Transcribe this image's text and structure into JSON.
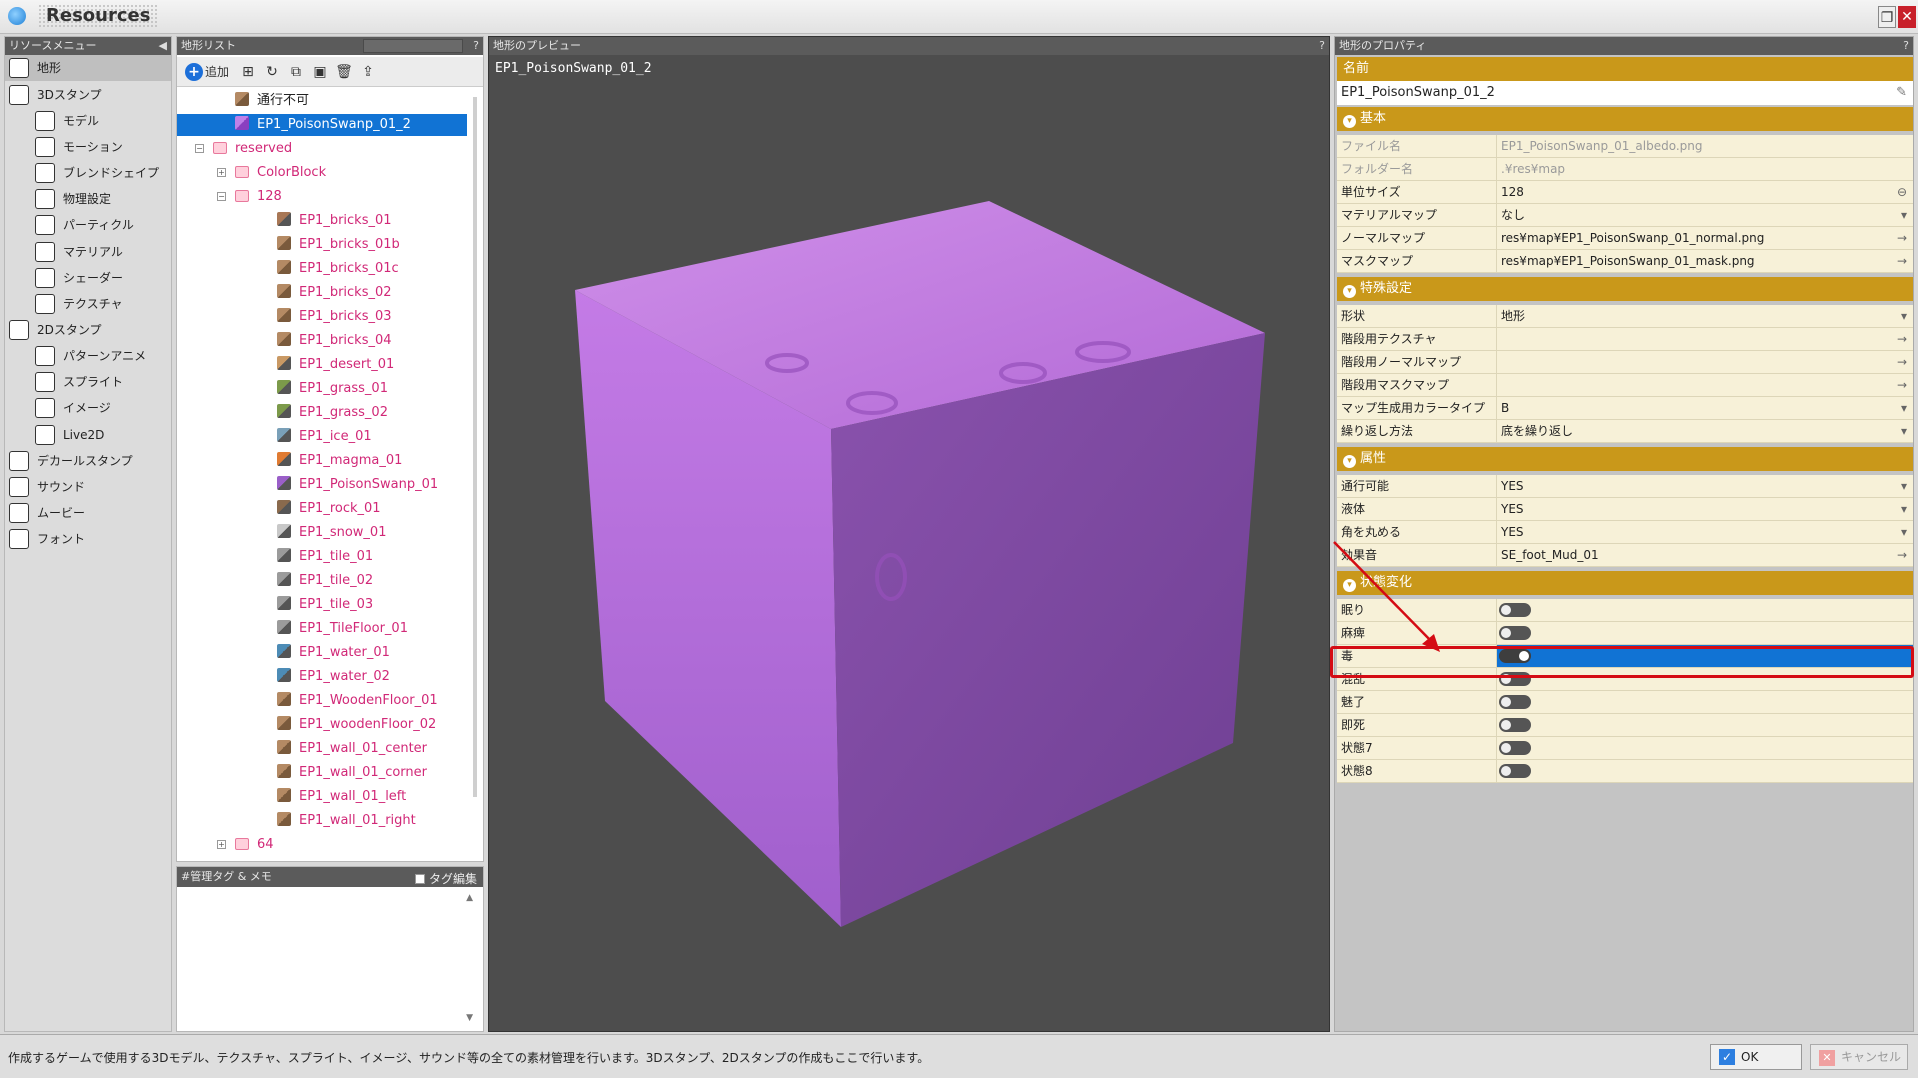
{
  "window": {
    "title": "Resources",
    "restore_icon": "restore-icon",
    "close_icon": "close-icon"
  },
  "menu": {
    "header": "リソースメニュー",
    "items": [
      {
        "label": "地形",
        "icon": "terrain-icon",
        "active": true
      },
      {
        "label": "3Dスタンプ",
        "icon": "3d-stamp-icon"
      },
      {
        "label": "モデル",
        "icon": "model-icon"
      },
      {
        "label": "モーション",
        "icon": "motion-icon"
      },
      {
        "label": "ブレンドシェイプ",
        "icon": "blend-shape-icon"
      },
      {
        "label": "物理設定",
        "icon": "physics-icon"
      },
      {
        "label": "パーティクル",
        "icon": "particle-icon"
      },
      {
        "label": "マテリアル",
        "icon": "material-icon"
      },
      {
        "label": "シェーダー",
        "icon": "shader-icon"
      },
      {
        "label": "テクスチャ",
        "icon": "texture-icon"
      },
      {
        "label": "2Dスタンプ",
        "icon": "2d-stamp-icon"
      },
      {
        "label": "パターンアニメ",
        "icon": "pattern-anime-icon"
      },
      {
        "label": "スプライト",
        "icon": "sprite-icon"
      },
      {
        "label": "イメージ",
        "icon": "image-icon"
      },
      {
        "label": "Live2D",
        "icon": "live2d-icon"
      },
      {
        "label": "デカールスタンプ",
        "icon": "decal-stamp-icon"
      },
      {
        "label": "サウンド",
        "icon": "sound-icon"
      },
      {
        "label": "ムービー",
        "icon": "movie-icon"
      },
      {
        "label": "フォント",
        "icon": "font-icon"
      }
    ]
  },
  "list": {
    "header": "地形リスト",
    "add_label": "追加",
    "tree": [
      {
        "label": "通行不可"
      },
      {
        "label": "EP1_PoisonSwanp_01_2"
      },
      {
        "label": "reserved"
      },
      {
        "label": "ColorBlock"
      },
      {
        "label": "128"
      },
      {
        "label": "EP1_bricks_01"
      },
      {
        "label": "EP1_bricks_01b"
      },
      {
        "label": "EP1_bricks_01c"
      },
      {
        "label": "EP1_bricks_02"
      },
      {
        "label": "EP1_bricks_03"
      },
      {
        "label": "EP1_bricks_04"
      },
      {
        "label": "EP1_desert_01"
      },
      {
        "label": "EP1_grass_01"
      },
      {
        "label": "EP1_grass_02"
      },
      {
        "label": "EP1_ice_01"
      },
      {
        "label": "EP1_magma_01"
      },
      {
        "label": "EP1_PoisonSwanp_01"
      },
      {
        "label": "EP1_rock_01"
      },
      {
        "label": "EP1_snow_01"
      },
      {
        "label": "EP1_tile_01"
      },
      {
        "label": "EP1_tile_02"
      },
      {
        "label": "EP1_tile_03"
      },
      {
        "label": "EP1_TileFloor_01"
      },
      {
        "label": "EP1_water_01"
      },
      {
        "label": "EP1_water_02"
      },
      {
        "label": "EP1_WoodenFloor_01"
      },
      {
        "label": "EP1_woodenFloor_02"
      },
      {
        "label": "EP1_wall_01_center"
      },
      {
        "label": "EP1_wall_01_corner"
      },
      {
        "label": "EP1_wall_01_left"
      },
      {
        "label": "EP1_wall_01_right"
      },
      {
        "label": "64"
      }
    ]
  },
  "tags": {
    "header": "#管理タグ & メモ",
    "edit_label": "タグ編集"
  },
  "preview": {
    "header": "地形のプレビュー",
    "label": "EP1_PoisonSwanp_01_2"
  },
  "props": {
    "header": "地形のプロパティ",
    "name_section": "名前",
    "name_value": "EP1_PoisonSwanp_01_2",
    "basic_section": "基本",
    "basic": [
      {
        "key": "ファイル名",
        "value": "EP1_PoisonSwanp_01_albedo.png"
      },
      {
        "key": "フォルダー名",
        "value": ".¥res¥map"
      },
      {
        "key": "単位サイズ",
        "value": "128"
      },
      {
        "key": "マテリアルマップ",
        "value": "なし"
      },
      {
        "key": "ノーマルマップ",
        "value": "res¥map¥EP1_PoisonSwanp_01_normal.png"
      },
      {
        "key": "マスクマップ",
        "value": "res¥map¥EP1_PoisonSwanp_01_mask.png"
      }
    ],
    "special_section": "特殊設定",
    "special": [
      {
        "key": "形状",
        "value": "地形"
      },
      {
        "key": "階段用テクスチャ",
        "value": ""
      },
      {
        "key": "階段用ノーマルマップ",
        "value": ""
      },
      {
        "key": "階段用マスクマップ",
        "value": ""
      },
      {
        "key": "マップ生成用カラータイプ",
        "value": "B"
      },
      {
        "key": "繰り返し方法",
        "value": "底を繰り返し"
      }
    ],
    "attr_section": "属性",
    "attrs": [
      {
        "key": "通行可能",
        "value": "YES"
      },
      {
        "key": "液体",
        "value": "YES"
      },
      {
        "key": "角を丸める",
        "value": "YES"
      },
      {
        "key": "効果音",
        "value": "SE_foot_Mud_01"
      }
    ],
    "status_section": "状態変化",
    "status": [
      {
        "key": "眠り",
        "on": false
      },
      {
        "key": "麻痺",
        "on": false
      },
      {
        "key": "毒",
        "on": true
      },
      {
        "key": "混乱",
        "on": false
      },
      {
        "key": "魅了",
        "on": false
      },
      {
        "key": "即死",
        "on": false
      },
      {
        "key": "状態7",
        "on": false
      },
      {
        "key": "状態8",
        "on": false
      }
    ]
  },
  "status_bar": {
    "text": "作成するゲームで使用する3Dモデル、テクスチャ、スプライト、イメージ、サウンド等の全ての素材管理を行います。3Dスタンプ、2Dスタンプの作成もここで行います。",
    "ok_label": "OK",
    "cancel_label": "キャンセル"
  },
  "colors": {
    "accent": "#1173d4",
    "section": "#c9981a",
    "highlight": "#d40c14",
    "cube_top": "#c080e0",
    "cube_front": "#7e4aa0",
    "cube_left": "#b06fd8"
  }
}
